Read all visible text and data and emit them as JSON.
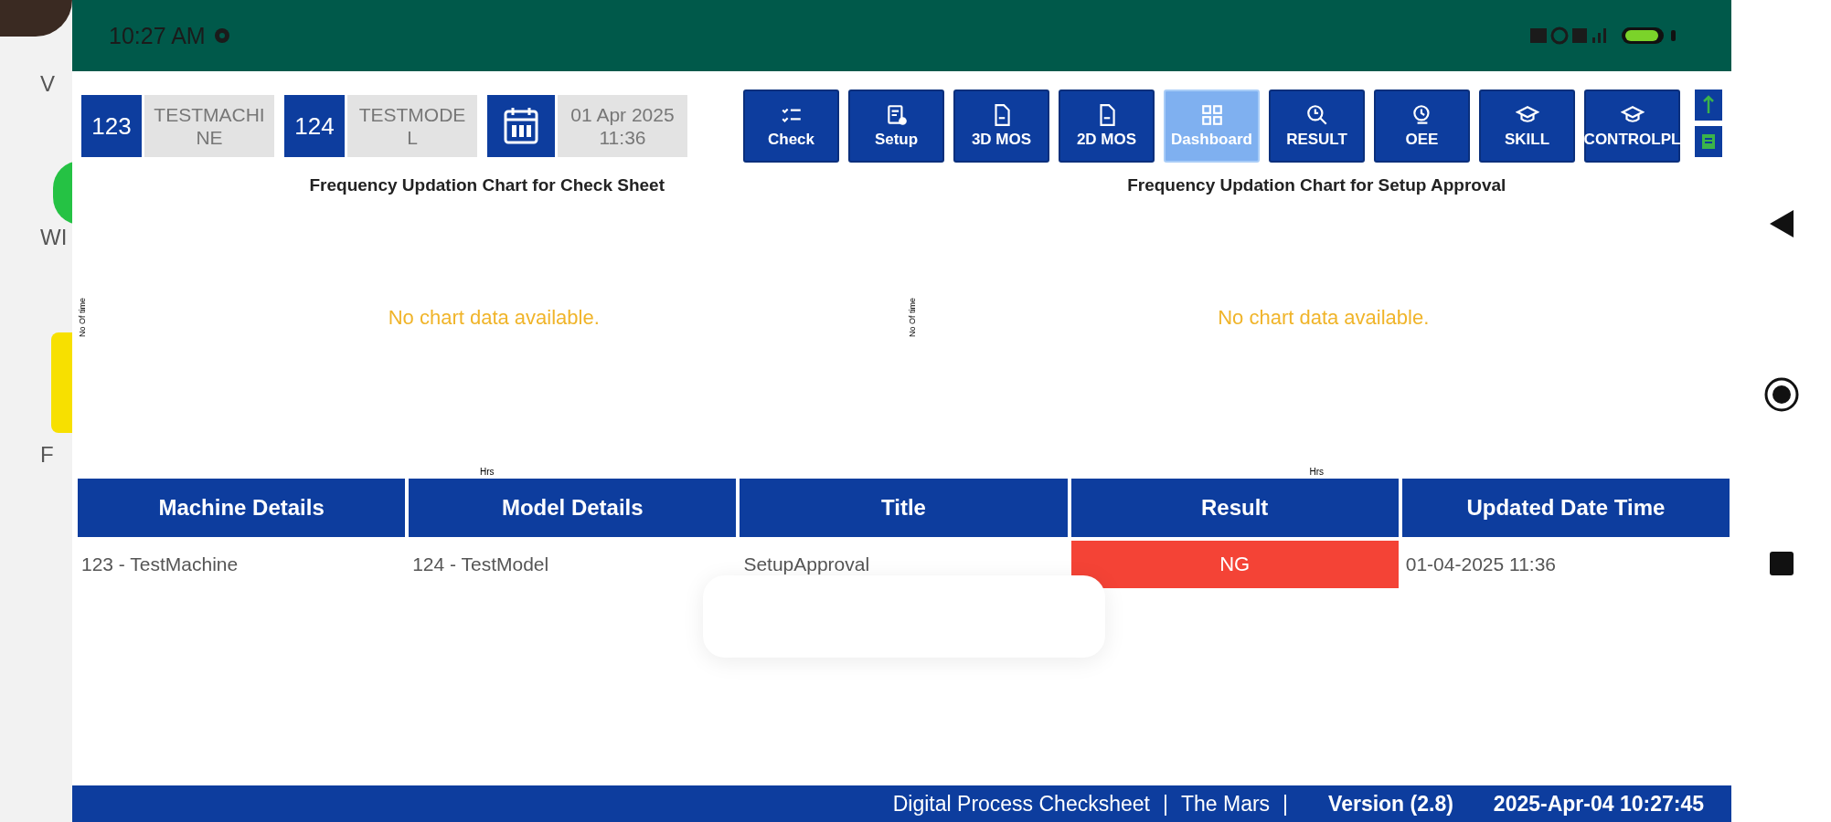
{
  "status_bar": {
    "time": "10:27 AM"
  },
  "background_app": {
    "texts": [
      "V",
      "WI",
      "F"
    ]
  },
  "header": {
    "machine": {
      "code": "123",
      "name": "TESTMACHINE"
    },
    "model": {
      "code": "124",
      "name": "TESTMODEL"
    },
    "date": "01 Apr 2025 11:36"
  },
  "nav_buttons": [
    {
      "label": "Check",
      "kind": "checklist",
      "selected": false
    },
    {
      "label": "Setup",
      "kind": "form",
      "selected": false
    },
    {
      "label": "3D MOS",
      "kind": "file",
      "selected": false
    },
    {
      "label": "2D MOS",
      "kind": "file",
      "selected": false
    },
    {
      "label": "Dashboard",
      "kind": "grid",
      "selected": true
    },
    {
      "label": "RESULT",
      "kind": "search",
      "selected": false
    },
    {
      "label": "OEE",
      "kind": "clock",
      "selected": false
    },
    {
      "label": "SKILL",
      "kind": "cap",
      "selected": false
    },
    {
      "label": "CONTROLPL",
      "kind": "cap",
      "selected": false
    }
  ],
  "charts": [
    {
      "title": "Frequency Updation Chart for Check Sheet",
      "ylabel": "No Of time",
      "message": "No chart data available.",
      "xlabel": "Hrs"
    },
    {
      "title": "Frequency Updation Chart for Setup Approval",
      "ylabel": "No Of time",
      "message": "No chart data available.",
      "xlabel": "Hrs"
    }
  ],
  "table": {
    "columns": [
      "Machine Details",
      "Model Details",
      "Title",
      "Result",
      "Updated Date Time"
    ],
    "rows": [
      {
        "machine": "123 - TestMachine",
        "model": "124 - TestModel",
        "title": "SetupApproval",
        "result": "NG",
        "result_ok": false,
        "updated": "01-04-2025 11:36"
      }
    ]
  },
  "footer": {
    "items": [
      {
        "text": "Digital Process Checksheet",
        "kind": "text"
      },
      {
        "text": "|",
        "kind": "sep"
      },
      {
        "text": "The Mars",
        "kind": "text"
      },
      {
        "text": "|",
        "kind": "sep"
      },
      {
        "text": "Version (2.8)",
        "kind": "bold"
      },
      {
        "text": "2025-Apr-04 10:27:45",
        "kind": "bold"
      }
    ]
  }
}
